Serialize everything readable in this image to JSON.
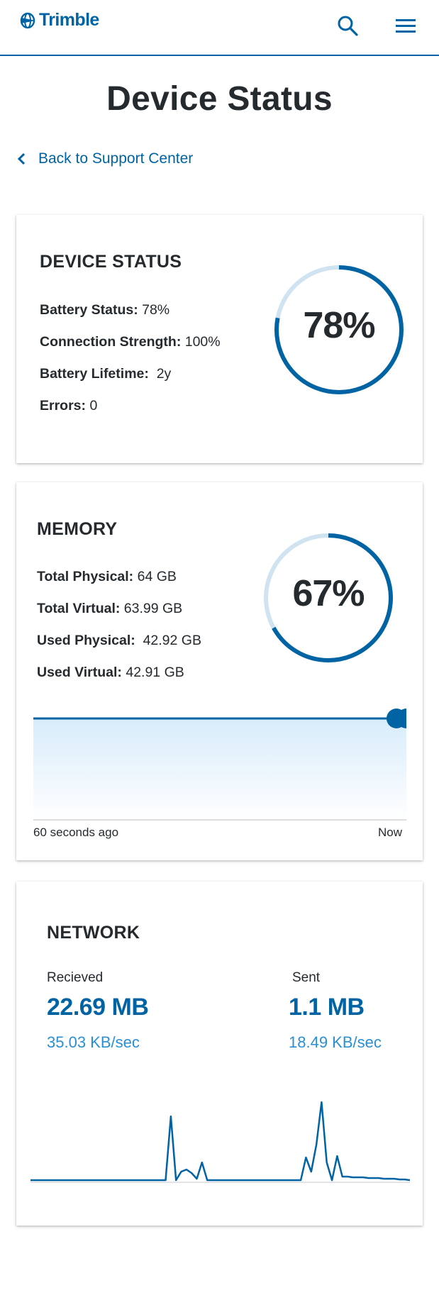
{
  "header": {
    "brand": "Trimble",
    "search_icon": "search-icon",
    "menu_icon": "hamburger-menu-icon"
  },
  "page": {
    "title": "Device Status",
    "back_link": "Back to Support Center"
  },
  "device_status": {
    "title": "DEVICE STATUS",
    "rows": [
      {
        "label": "Battery Status:",
        "value": " 78%"
      },
      {
        "label": "Connection Strength:",
        "value": " 100%"
      },
      {
        "label": "Battery Lifetime:",
        "value": "  2y"
      },
      {
        "label": "Errors:",
        "value": " 0"
      }
    ],
    "gauge": {
      "value": 78,
      "label": "78%"
    }
  },
  "memory": {
    "title": "MEMORY",
    "rows": [
      {
        "label": "Total Physical:",
        "value": " 64 GB"
      },
      {
        "label": "Total Virtual:",
        "value": " 63.99 GB"
      },
      {
        "label": "Used Physical:",
        "value": "  42.92 GB"
      },
      {
        "label": "Used Virtual:",
        "value": " 42.91 GB"
      }
    ],
    "gauge": {
      "value": 67,
      "label": "67%"
    },
    "chart_start_label": "60 seconds ago",
    "chart_end_label": "Now"
  },
  "network": {
    "title": "NETWORK",
    "received": {
      "label": "Recieved",
      "total": "22.69 MB",
      "rate": "35.03 KB/sec"
    },
    "sent": {
      "label": "Sent",
      "total": "1.1 MB",
      "rate": "18.49 KB/sec"
    }
  },
  "colors": {
    "primary": "#0063a3",
    "accent": "#2a8fd4",
    "track": "#cfe3f1",
    "text": "#252a2e"
  },
  "chart_data": [
    {
      "type": "area",
      "series": [
        {
          "values": [
            67,
            67,
            67,
            67,
            67,
            67,
            67,
            67,
            67,
            67,
            67,
            67,
            67,
            67,
            67,
            67,
            67,
            67,
            67,
            67,
            67,
            67,
            67,
            67,
            67,
            67,
            67,
            67,
            67,
            67,
            67
          ]
        }
      ],
      "xlabel": "",
      "ylabel": "",
      "ylim": [
        0,
        100
      ],
      "grid": false
    },
    {
      "type": "line",
      "series": [
        {
          "values": [
            0,
            0,
            0,
            0,
            0,
            0,
            0,
            0,
            0,
            0,
            0,
            0,
            0,
            0,
            0,
            0,
            0,
            0,
            0,
            0,
            0,
            0,
            0,
            0,
            0,
            0,
            0,
            90,
            0,
            12,
            15,
            10,
            2,
            25,
            0,
            0,
            0,
            0,
            0,
            0,
            0,
            0,
            0,
            0,
            0,
            0,
            0,
            0,
            0,
            0,
            0,
            0,
            0,
            32,
            12,
            50,
            110,
            25,
            0,
            34,
            5,
            5,
            4,
            4,
            4,
            3,
            3,
            3,
            2,
            2,
            2,
            1,
            1,
            0
          ]
        }
      ],
      "xlabel": "",
      "ylabel": "",
      "grid": false
    }
  ]
}
